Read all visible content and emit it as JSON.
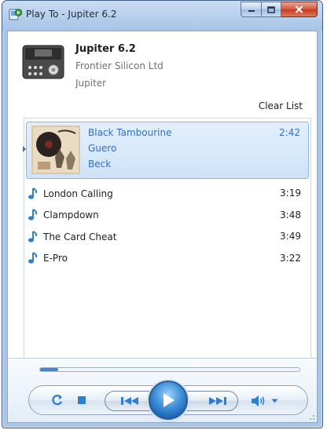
{
  "window": {
    "title": "Play To - Jupiter 6.2",
    "buttons": {
      "minimize_icon": "minimize-icon",
      "maximize_icon": "maximize-icon",
      "close_icon": "close-icon"
    }
  },
  "device": {
    "name": "Jupiter 6.2",
    "manufacturer": "Frontier Silicon Ltd",
    "model": "Jupiter"
  },
  "clear_list_label": "Clear List",
  "now_playing": {
    "title": "Black Tambourine",
    "album": "Guero",
    "artist": "Beck",
    "duration": "2:42"
  },
  "tracks": [
    {
      "title": "London Calling",
      "duration": "3:19"
    },
    {
      "title": "Clampdown",
      "duration": "3:48"
    },
    {
      "title": "The Card Cheat",
      "duration": "3:49"
    },
    {
      "title": "E-Pro",
      "duration": "3:22"
    }
  ],
  "playback": {
    "progress_fraction": 0.07
  },
  "colors": {
    "accent": "#3070c2",
    "selection_bg": "#d6e8fa",
    "play_button": "#2d7fd1"
  }
}
